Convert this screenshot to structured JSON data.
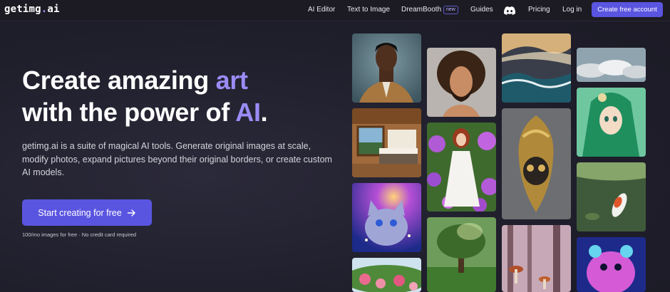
{
  "nav": {
    "logo_main": "getimg",
    "logo_dot": ".",
    "logo_suffix": "ai",
    "links": [
      "AI Editor",
      "Text to Image",
      "DreamBooth",
      "Guides",
      "Pricing",
      "Log in"
    ],
    "new_badge": "new",
    "discord_icon": "discord-icon",
    "cta": "Create free account"
  },
  "hero": {
    "line1_pre": "Create amazing ",
    "line1_accent": "art",
    "line2_pre": "with the power of ",
    "line2_accent": "AI",
    "line2_post": ".",
    "description": "getimg.ai is a suite of magical AI tools. Generate original images at scale, modify photos, expand pictures beyond their original borders, or create custom AI models.",
    "button": "Start creating for free",
    "button_icon": "arrow-right-icon",
    "note": "100/mo images for free · No credit card required"
  },
  "gallery": {
    "images": [
      "man-in-brown-suit-portrait",
      "curly-haired-man-portrait",
      "stormy-ocean-painting",
      "clouds-seascape",
      "wooden-bedroom-interior",
      "woman-in-white-dress-flowers",
      "golden-skull-ornament",
      "green-haired-anime-girl",
      "galaxy-cat",
      "koi-pond",
      "tree-in-meadow",
      "misty-forest-mushrooms",
      "neon-hamster",
      "rose-garden"
    ]
  },
  "colors": {
    "accent": "#9a8cf6",
    "button": "#5a55e0",
    "background": "#1f1e2b"
  }
}
